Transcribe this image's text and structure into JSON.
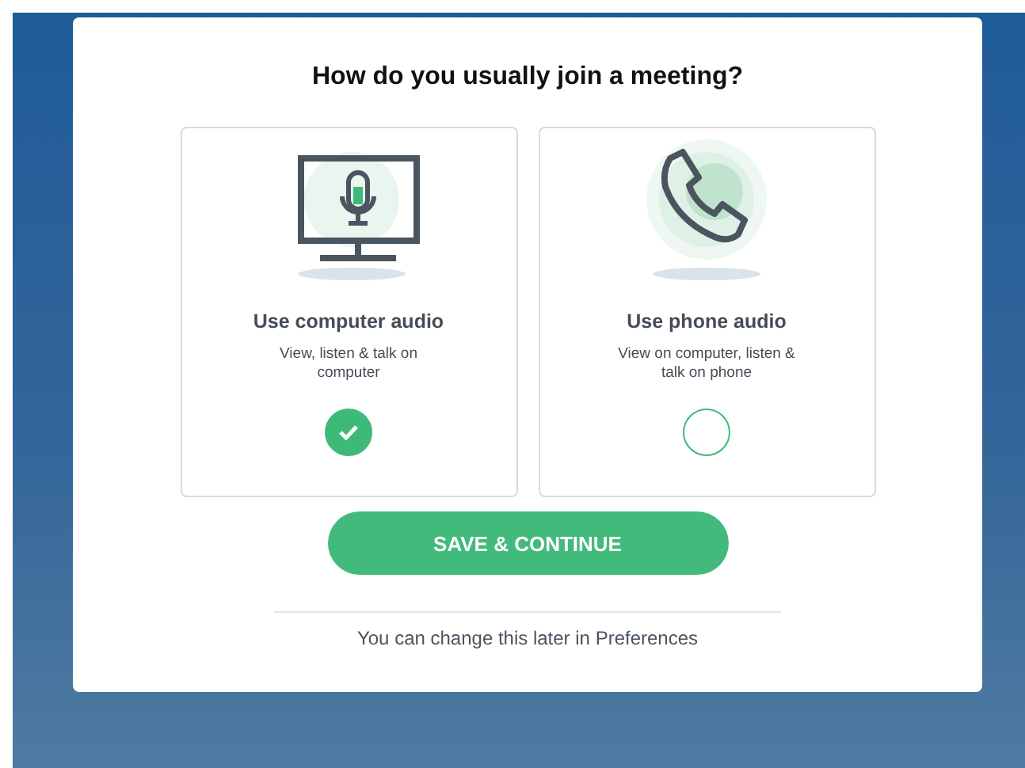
{
  "dialog": {
    "title": "How do you usually join a meeting?",
    "options": [
      {
        "kind": "computer",
        "title": "Use computer audio",
        "description": "View, listen & talk on computer",
        "selected": true
      },
      {
        "kind": "phone",
        "title": "Use phone audio",
        "description": "View on computer, listen & talk on phone",
        "selected": false
      }
    ],
    "button": "SAVE & CONTINUE",
    "footnote": "You can change this later in Preferences"
  }
}
